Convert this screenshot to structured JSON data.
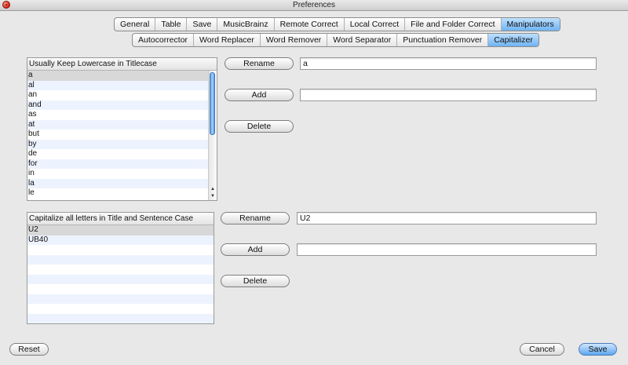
{
  "window": {
    "title": "Preferences"
  },
  "main_tabs": [
    "General",
    "Table",
    "Save",
    "MusicBrainz",
    "Remote Correct",
    "Local Correct",
    "File and Folder Correct",
    "Manipulators"
  ],
  "main_tab_active": "Manipulators",
  "sub_tabs": [
    "Autocorrector",
    "Word Replacer",
    "Word Remover",
    "Word Separator",
    "Punctuation Remover",
    "Capitalizer"
  ],
  "sub_tab_active": "Capitalizer",
  "lowercase_panel": {
    "header": "Usually Keep Lowercase in Titlecase",
    "items": [
      "a",
      "al",
      "an",
      "and",
      "as",
      "at",
      "but",
      "by",
      "de",
      "for",
      "in",
      "la",
      "le"
    ],
    "selected": "a",
    "rename_label": "Rename",
    "rename_value": "a",
    "add_label": "Add",
    "add_value": "",
    "delete_label": "Delete"
  },
  "uppercase_panel": {
    "header": "Capitalize all letters in Title and Sentence Case",
    "items": [
      "U2",
      "UB40"
    ],
    "selected": "U2",
    "rename_label": "Rename",
    "rename_value": "U2",
    "add_label": "Add",
    "add_value": "",
    "delete_label": "Delete"
  },
  "footer": {
    "reset_label": "Reset",
    "cancel_label": "Cancel",
    "save_label": "Save"
  }
}
